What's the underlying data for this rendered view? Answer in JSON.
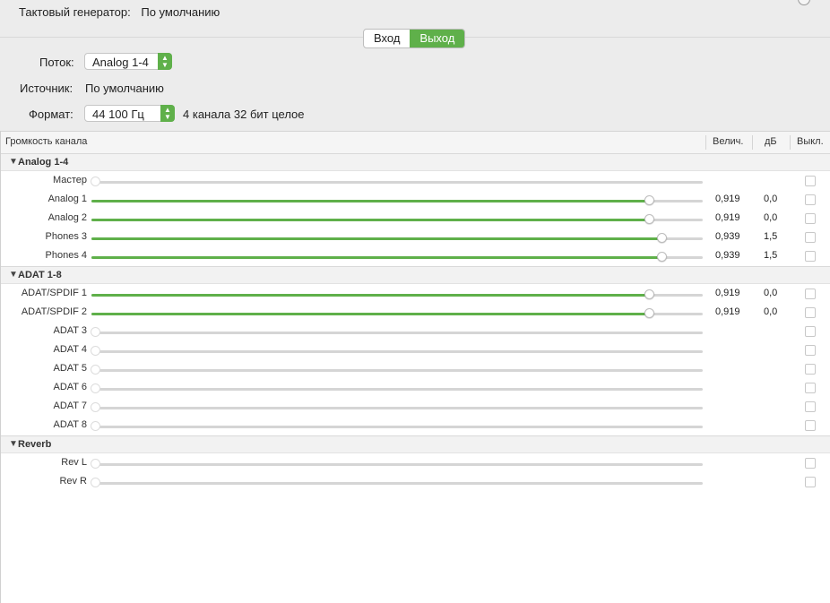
{
  "header": {
    "clock_label": "Тактовый генератор:",
    "clock_value": "По умолчанию"
  },
  "direction_tabs": [
    {
      "label": "Вход",
      "active": false
    },
    {
      "label": "Выход",
      "active": true
    }
  ],
  "form": {
    "stream_label": "Поток:",
    "stream_value": "Analog 1-4",
    "source_label": "Источник:",
    "source_value": "По умолчанию",
    "format_label": "Формат:",
    "format_value": "44 100 Гц",
    "format_detail": "4 канала 32 бит целое"
  },
  "table": {
    "columns": {
      "name": "Громкость канала",
      "value": "Велич.",
      "db": "дБ",
      "mute": "Выкл."
    },
    "groups": [
      {
        "name": "Analog 1-4",
        "channels": [
          {
            "name": "Мастер",
            "level": 0,
            "value": "",
            "db": "",
            "enabled": false
          },
          {
            "name": "Analog 1",
            "level": 0.919,
            "value": "0,919",
            "db": "0,0",
            "enabled": true
          },
          {
            "name": "Analog 2",
            "level": 0.919,
            "value": "0,919",
            "db": "0,0",
            "enabled": true
          },
          {
            "name": "Phones 3",
            "level": 0.939,
            "value": "0,939",
            "db": "1,5",
            "enabled": true
          },
          {
            "name": "Phones 4",
            "level": 0.939,
            "value": "0,939",
            "db": "1,5",
            "enabled": true
          }
        ]
      },
      {
        "name": "ADAT 1-8",
        "channels": [
          {
            "name": "ADAT/SPDIF 1",
            "level": 0.919,
            "value": "0,919",
            "db": "0,0",
            "enabled": true
          },
          {
            "name": "ADAT/SPDIF 2",
            "level": 0.919,
            "value": "0,919",
            "db": "0,0",
            "enabled": true
          },
          {
            "name": "ADAT 3",
            "level": 0,
            "value": "",
            "db": "",
            "enabled": false
          },
          {
            "name": "ADAT 4",
            "level": 0,
            "value": "",
            "db": "",
            "enabled": false
          },
          {
            "name": "ADAT 5",
            "level": 0,
            "value": "",
            "db": "",
            "enabled": false
          },
          {
            "name": "ADAT 6",
            "level": 0,
            "value": "",
            "db": "",
            "enabled": false
          },
          {
            "name": "ADAT 7",
            "level": 0,
            "value": "",
            "db": "",
            "enabled": false
          },
          {
            "name": "ADAT 8",
            "level": 0,
            "value": "",
            "db": "",
            "enabled": false
          }
        ]
      },
      {
        "name": "Reverb",
        "channels": [
          {
            "name": "Rev L",
            "level": 0,
            "value": "",
            "db": "",
            "enabled": false
          },
          {
            "name": "Rev R",
            "level": 0,
            "value": "",
            "db": "",
            "enabled": false
          }
        ]
      }
    ]
  },
  "colors": {
    "accent": "#5fb04a",
    "track": "#d5d5d5",
    "window_bg": "#ececec"
  },
  "icons": {
    "group_toggle": "triangle-down-icon",
    "select_arrows": "chevron-updown-icon"
  }
}
